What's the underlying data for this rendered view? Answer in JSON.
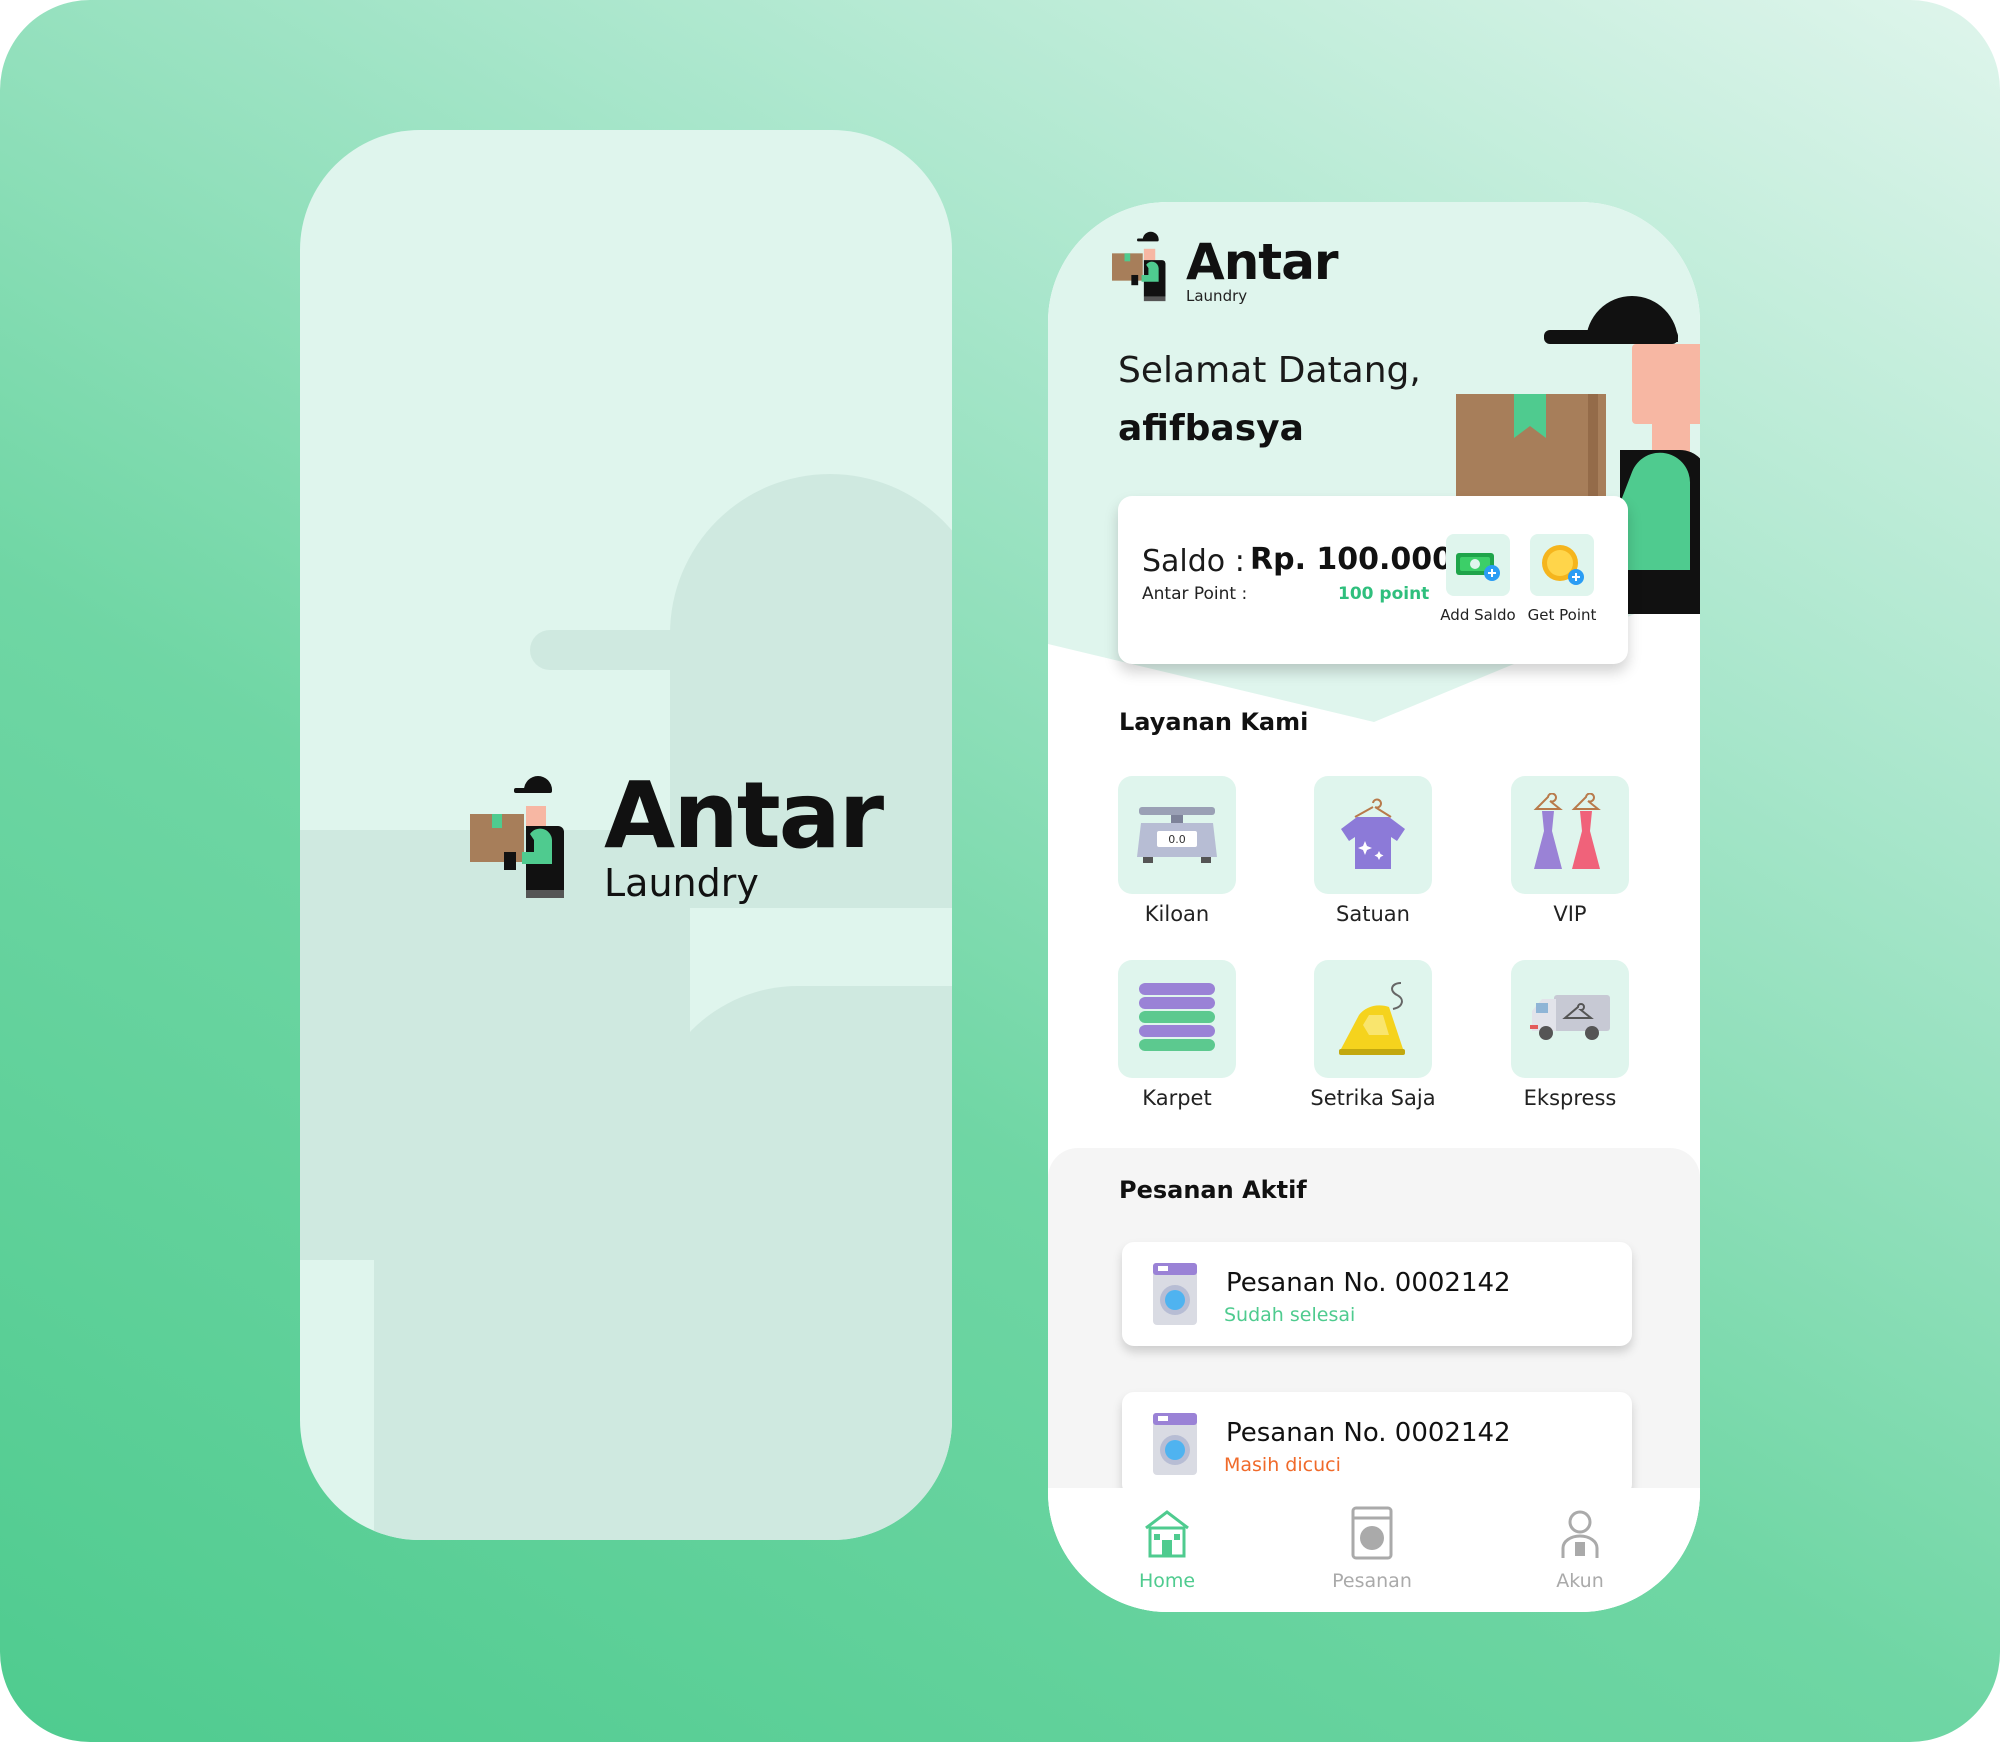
{
  "brand": {
    "name": "Antar",
    "subtitle": "Laundry",
    "accent": "#4fcb8f",
    "tile_bg": "#dff5ed"
  },
  "home": {
    "greeting": "Selamat Datang,",
    "username": "afifbasya",
    "wallet": {
      "saldo_label": "Saldo :",
      "saldo_value": "Rp. 100.000",
      "point_label": "Antar Point :",
      "point_value": "100 point",
      "add_saldo_label": "Add Saldo",
      "get_point_label": "Get Point"
    },
    "services_title": "Layanan Kami",
    "services": [
      {
        "label": "Kiloan",
        "icon": "scale-icon"
      },
      {
        "label": "Satuan",
        "icon": "shirt-icon"
      },
      {
        "label": "VIP",
        "icon": "dress-icon"
      },
      {
        "label": "Karpet",
        "icon": "carpet-icon"
      },
      {
        "label": "Setrika Saja",
        "icon": "iron-icon"
      },
      {
        "label": "Ekspress",
        "icon": "delivery-van-icon"
      }
    ],
    "scale_reading": "0.0",
    "orders_title": "Pesanan Aktif",
    "orders": [
      {
        "title": "Pesanan No. 0002142",
        "status": "Sudah selesai",
        "status_color": "#4fcb8f"
      },
      {
        "title": "Pesanan No. 0002142",
        "status": "Masih dicuci",
        "status_color": "#f06a2a"
      }
    ],
    "nav": [
      {
        "label": "Home",
        "icon": "home-icon",
        "active": true
      },
      {
        "label": "Pesanan",
        "icon": "washing-machine-icon",
        "active": false
      },
      {
        "label": "Akun",
        "icon": "user-icon",
        "active": false
      }
    ]
  }
}
